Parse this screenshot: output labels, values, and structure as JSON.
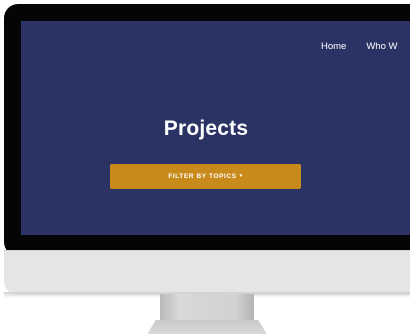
{
  "nav": {
    "items": [
      "Home",
      "Who W"
    ]
  },
  "hero": {
    "title": "Projects",
    "filter_button_label": "FILTER BY TOPICS",
    "filter_button_caret": "▾"
  },
  "colors": {
    "screen_background": "#2a3364",
    "button_accent": "#c98a1c",
    "text": "#ffffff"
  }
}
